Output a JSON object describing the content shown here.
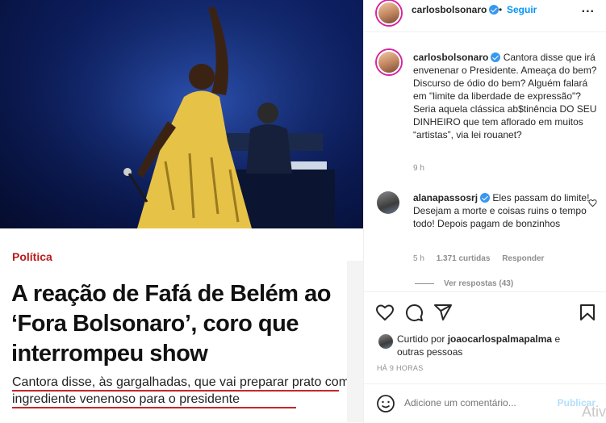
{
  "article": {
    "category": "Política",
    "headline": "A reação de Fafá de Belém ao ‘Fora Bolsonaro’, coro que interrompeu show",
    "lead": "Cantora disse, às gargalhadas, que vai preparar prato com ingrediente venenoso para o presidente"
  },
  "header": {
    "username": "carlosbolsonaro",
    "separator": "•",
    "follow_label": "Seguir",
    "more": "..."
  },
  "caption": {
    "username": "carlosbolsonaro",
    "text": "Cantora disse que irá envenenar o Presidente. Ameaça do bem? Discurso de ódio do bem? Alguém falará em \"limite da liberdade de expressão\"? Seria aquela clássica ab$tinência DO SEU DINHEIRO que tem aflorado em muitos “artistas”, via lei rouanet?",
    "time": "9 h"
  },
  "comment": {
    "username": "alanapassosrj",
    "text": "Eles passam do limite! Desejam a morte e coisas ruins o tempo todo! Depois pagam de bonzinhos",
    "time": "5 h",
    "likes": "1.371 curtidas",
    "reply_label": "Responder",
    "view_replies": "Ver respostas (43)"
  },
  "liked_by": {
    "prefix": "Curtido por",
    "user": "joaocarlospalmapalma",
    "suffix": "e",
    "others": "outras pessoas"
  },
  "time_ago": "HÁ 9 HORAS",
  "add_comment": {
    "placeholder": "Adicione um comentário...",
    "publish_label": "Publicar"
  },
  "watermark": "Ativ",
  "colors": {
    "accent": "#0095f6",
    "article_red": "#c62828",
    "muted": "#8e8e8e"
  },
  "icons": [
    "verified-badge-icon",
    "more-options-icon",
    "heart-icon",
    "comment-icon",
    "share-icon",
    "bookmark-icon",
    "emoji-icon"
  ]
}
